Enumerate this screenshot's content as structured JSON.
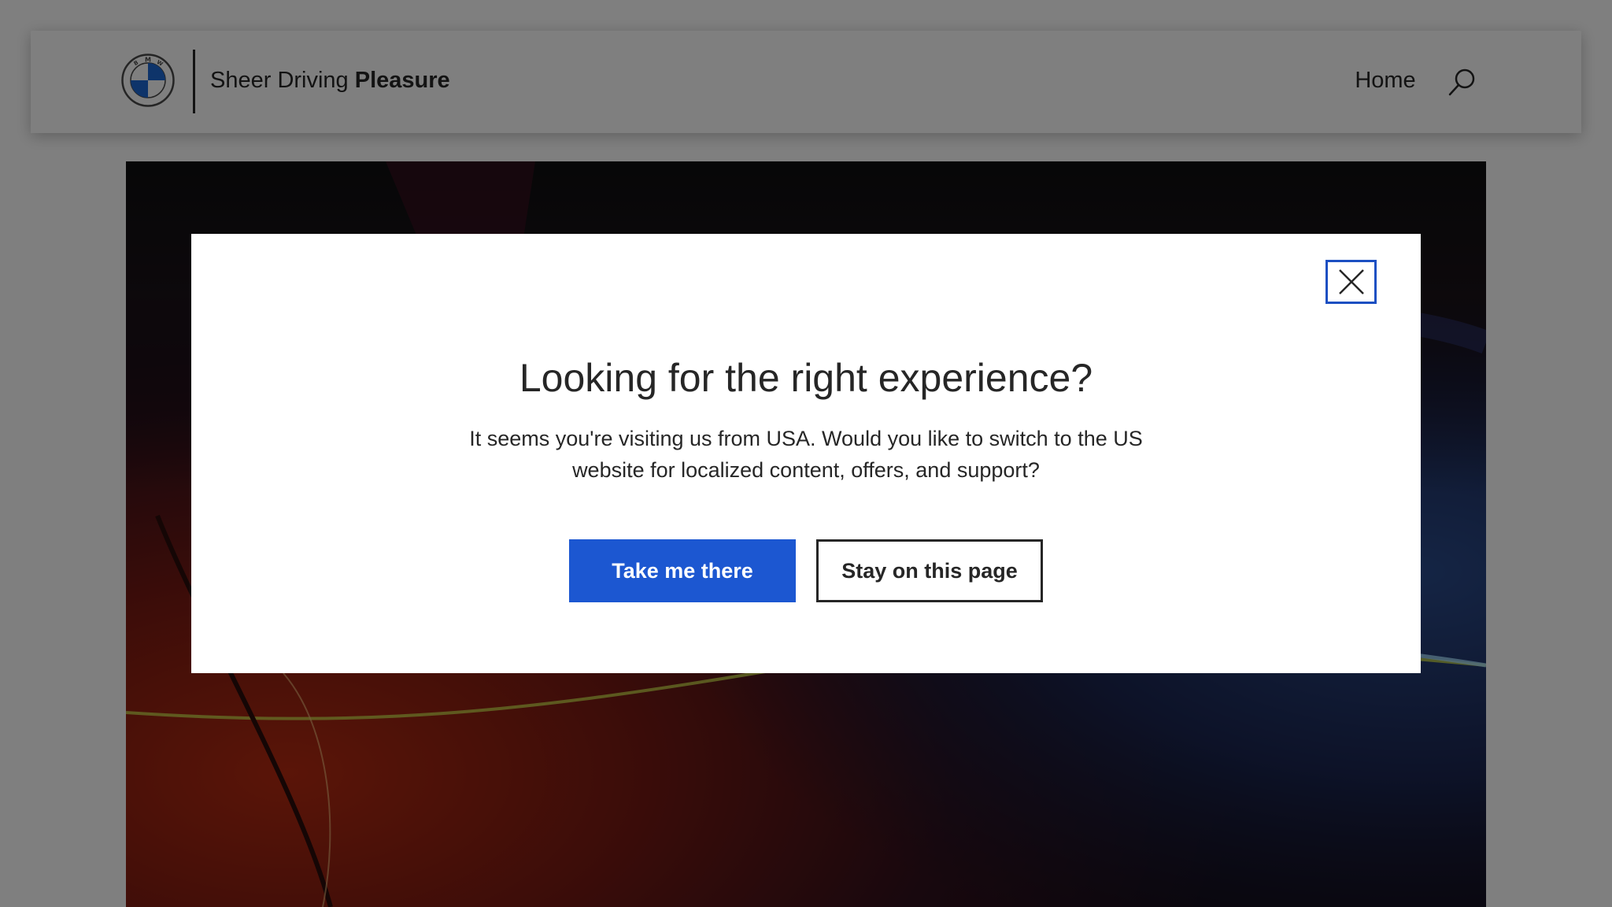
{
  "header": {
    "logo": "bmw-roundel-logo",
    "logo_letters": "BMW",
    "tagline_regular": "Sheer Driving",
    "tagline_bold": "Pleasure",
    "nav_home": "Home",
    "search_icon": "search-icon"
  },
  "hero": {
    "image": "car-body-closeup-red-blue-lighting"
  },
  "modal": {
    "close_icon": "close-icon",
    "title": "Looking for the right experience?",
    "body": "It seems you're visiting us from USA. Would you like to switch to the US website for localized content, offers, and support?",
    "primary_button": "Take me there",
    "secondary_button": "Stay on this page"
  },
  "colors": {
    "primary_button": "#1c57d1",
    "focus_outline": "#1c4fc2",
    "text": "#262626",
    "overlay": "rgba(0,0,0,0.5)"
  }
}
